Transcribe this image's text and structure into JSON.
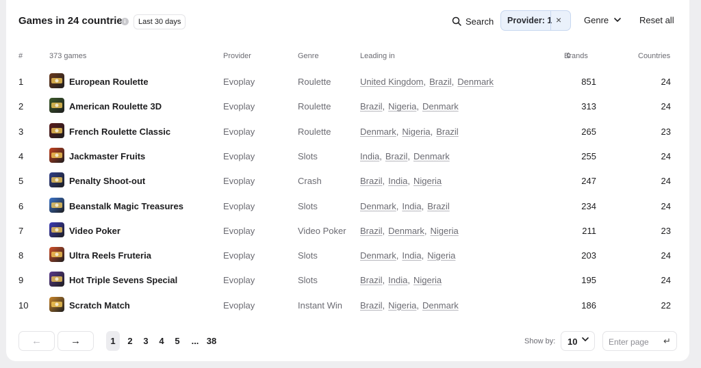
{
  "header": {
    "title": "Games in 24 countries",
    "info_icon": "i",
    "period": "Last 30 days",
    "search_label": "Search",
    "provider_chip": "Provider: 1",
    "provider_clear": "×",
    "genre_label": "Genre",
    "reset_label": "Reset all"
  },
  "columns": {
    "rank": "#",
    "games": "373 games",
    "provider": "Provider",
    "genre": "Genre",
    "leading": "Leading in",
    "brands": "Brands",
    "countries": "Countries"
  },
  "rows": [
    {
      "rank": "1",
      "name": "European Roulette",
      "provider": "Evoplay",
      "genre": "Roulette",
      "leading": [
        "United Kingdom",
        "Brazil",
        "Denmark"
      ],
      "brands": "851",
      "countries": "24",
      "icon_color": "#6b3a1e"
    },
    {
      "rank": "2",
      "name": "American Roulette 3D",
      "provider": "Evoplay",
      "genre": "Roulette",
      "leading": [
        "Brazil",
        "Nigeria",
        "Denmark"
      ],
      "brands": "313",
      "countries": "24",
      "icon_color": "#3c5a2a"
    },
    {
      "rank": "3",
      "name": "French Roulette Classic",
      "provider": "Evoplay",
      "genre": "Roulette",
      "leading": [
        "Denmark",
        "Nigeria",
        "Brazil"
      ],
      "brands": "265",
      "countries": "23",
      "icon_color": "#5a1c1c"
    },
    {
      "rank": "4",
      "name": "Jackmaster Fruits",
      "provider": "Evoplay",
      "genre": "Slots",
      "leading": [
        "India",
        "Brazil",
        "Denmark"
      ],
      "brands": "255",
      "countries": "24",
      "icon_color": "#c4421f"
    },
    {
      "rank": "5",
      "name": "Penalty Shoot-out",
      "provider": "Evoplay",
      "genre": "Crash",
      "leading": [
        "Brazil",
        "India",
        "Nigeria"
      ],
      "brands": "247",
      "countries": "24",
      "icon_color": "#2f3f8a"
    },
    {
      "rank": "6",
      "name": "Beanstalk Magic Treasures",
      "provider": "Evoplay",
      "genre": "Slots",
      "leading": [
        "Denmark",
        "India",
        "Brazil"
      ],
      "brands": "234",
      "countries": "24",
      "icon_color": "#3a73c9"
    },
    {
      "rank": "7",
      "name": "Video Poker",
      "provider": "Evoplay",
      "genre": "Video Poker",
      "leading": [
        "Brazil",
        "Denmark",
        "Nigeria"
      ],
      "brands": "211",
      "countries": "23",
      "icon_color": "#3b3bb8"
    },
    {
      "rank": "8",
      "name": "Ultra Reels Fruteria",
      "provider": "Evoplay",
      "genre": "Slots",
      "leading": [
        "Denmark",
        "India",
        "Nigeria"
      ],
      "brands": "203",
      "countries": "24",
      "icon_color": "#d2512a"
    },
    {
      "rank": "9",
      "name": "Hot Triple Sevens Special",
      "provider": "Evoplay",
      "genre": "Slots",
      "leading": [
        "Brazil",
        "India",
        "Nigeria"
      ],
      "brands": "195",
      "countries": "24",
      "icon_color": "#5a3a8c"
    },
    {
      "rank": "10",
      "name": "Scratch Match",
      "provider": "Evoplay",
      "genre": "Instant Win",
      "leading": [
        "Brazil",
        "Nigeria",
        "Denmark"
      ],
      "brands": "186",
      "countries": "22",
      "icon_color": "#c9862a"
    }
  ],
  "pagination": {
    "prev": "←",
    "next": "→",
    "pages": [
      "1",
      "2",
      "3",
      "4",
      "5",
      "...",
      "38"
    ],
    "active_page": "1",
    "show_by_label": "Show by:",
    "per_page": "10",
    "enter_placeholder": "Enter page",
    "enter_icon": "↵"
  }
}
